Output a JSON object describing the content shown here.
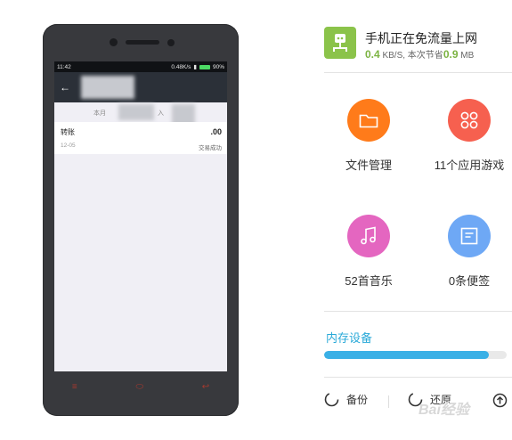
{
  "phone": {
    "status_time": "11:42",
    "status_speed": "0.48K/s",
    "status_battery": "90%",
    "tab_left": "本月",
    "tab_mid": "支",
    "tab_right": "入",
    "transaction": {
      "name": "转账",
      "date": "12-05",
      "amount": ".00",
      "status": "交易成功"
    }
  },
  "flow": {
    "title": "手机正在免流量上网",
    "speed_value": "0.4",
    "speed_unit": " KB/S, 本次节省",
    "saved_value": "0.9",
    "saved_unit": " MB"
  },
  "tiles": [
    {
      "label": "文件管理",
      "color": "#ff7b1a",
      "icon": "folder-icon"
    },
    {
      "label": "11个应用游戏",
      "color": "#f6604f",
      "icon": "apps-grid-icon"
    },
    {
      "label": "52首音乐",
      "color": "#e466c0",
      "icon": "music-note-icon"
    },
    {
      "label": "0条便签",
      "color": "#6ea8f5",
      "icon": "note-icon"
    }
  ],
  "storage": {
    "label": "内存设备",
    "fill_fraction": 0.9
  },
  "bottom": {
    "backup_label": "备份",
    "restore_label": "还原"
  },
  "watermark_text": "Bai经验"
}
